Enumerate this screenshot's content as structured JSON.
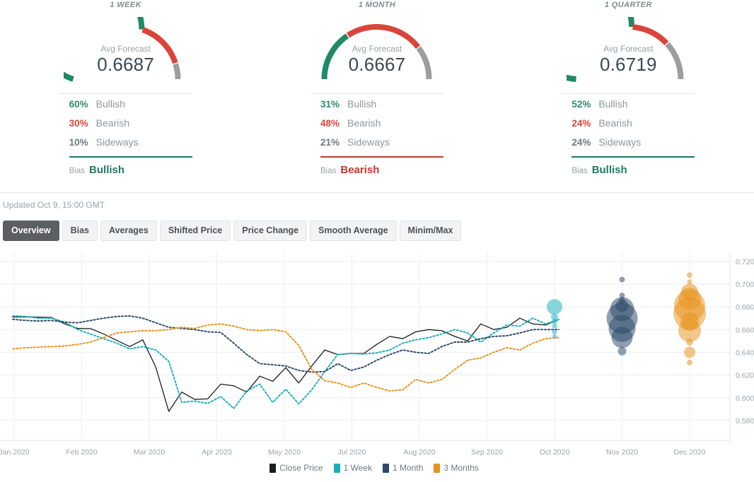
{
  "panels": [
    {
      "title": "1 WEEK",
      "gauge_caption": "Avg Forecast",
      "value": "0.6687",
      "bullish_pct": "60%",
      "bullish_label": "Bullish",
      "bearish_pct": "30%",
      "bearish_label": "Bearish",
      "sideways_pct": "10%",
      "sideways_label": "Sideways",
      "bias_label": "Bias",
      "bias_value": "Bullish",
      "bias_color": "#1f7a63",
      "arc": {
        "green": 60,
        "red": 30,
        "gray": 10
      }
    },
    {
      "title": "1 MONTH",
      "gauge_caption": "Avg Forecast",
      "value": "0.6667",
      "bullish_pct": "31%",
      "bullish_label": "Bullish",
      "bearish_pct": "48%",
      "bearish_label": "Bearish",
      "sideways_pct": "21%",
      "sideways_label": "Sideways",
      "bias_label": "Bias",
      "bias_value": "Bearish",
      "bias_color": "#c0392b",
      "arc": {
        "green": 31,
        "red": 48,
        "gray": 21
      }
    },
    {
      "title": "1 QUARTER",
      "gauge_caption": "Avg Forecast",
      "value": "0.6719",
      "bullish_pct": "52%",
      "bullish_label": "Bullish",
      "bearish_pct": "24%",
      "bearish_label": "Bearish",
      "sideways_pct": "24%",
      "sideways_label": "Sideways",
      "bias_label": "Bias",
      "bias_value": "Bullish",
      "bias_color": "#1f7a63",
      "arc": {
        "green": 52,
        "red": 24,
        "gray": 24
      }
    }
  ],
  "updated": "Updated Oct 9, 15:00 GMT",
  "tabs": [
    {
      "label": "Overview",
      "active": true
    },
    {
      "label": "Bias",
      "active": false
    },
    {
      "label": "Averages",
      "active": false
    },
    {
      "label": "Shifted Price",
      "active": false
    },
    {
      "label": "Price Change",
      "active": false
    },
    {
      "label": "Smooth Average",
      "active": false
    },
    {
      "label": "Minim/Max",
      "active": false
    }
  ],
  "colors": {
    "green": "#1f8a64",
    "red": "#d9453a",
    "gray": "#9e9e9e",
    "close_price": "#1c1c1c",
    "one_week": "#17b0bd",
    "one_month": "#2b4868",
    "three_months": "#e8931f"
  },
  "chart_data": {
    "type": "line",
    "title": "",
    "xlabel": "",
    "ylabel": "",
    "ylim": [
      0.57,
      0.7255
    ],
    "grid": true,
    "legend_position": "bottom",
    "yticks": [
      "0.7200",
      "0.7000",
      "0.6800",
      "0.6600",
      "0.6400",
      "0.6200",
      "0.6000",
      "0.5800"
    ],
    "ytick_values": [
      0.72,
      0.7,
      0.68,
      0.66,
      0.64,
      0.62,
      0.6,
      0.58
    ],
    "xticks": [
      "Jan 2020",
      "Feb 2020",
      "Mar 2020",
      "Apr 2020",
      "May 2020",
      "Jul 2020",
      "Aug 2020",
      "Sep 2020",
      "Oct 2020",
      "Nov 2020",
      "Dec 2020"
    ],
    "legend": [
      {
        "name": "Close Price",
        "color": "#1c1c1c"
      },
      {
        "name": "1 Week",
        "color": "#17b0bd"
      },
      {
        "name": "1 Month",
        "color": "#2b4868"
      },
      {
        "name": "3 Months",
        "color": "#e8931f"
      }
    ],
    "series": [
      {
        "name": "Close Price",
        "color": "#1c1c1c",
        "style": "solid",
        "values": [
          0.671,
          0.6712,
          0.6709,
          0.6706,
          0.665,
          0.661,
          0.6608,
          0.656,
          0.6505,
          0.645,
          0.651,
          0.627,
          0.588,
          0.605,
          0.5985,
          0.599,
          0.612,
          0.6105,
          0.605,
          0.619,
          0.6145,
          0.6265,
          0.613,
          0.628,
          0.642,
          0.638,
          0.639,
          0.639,
          0.647,
          0.654,
          0.652,
          0.658,
          0.66,
          0.659,
          0.654,
          0.65,
          0.665,
          0.66,
          0.662,
          0.67,
          0.665,
          0.664,
          0.669
        ]
      },
      {
        "name": "1 Week",
        "color": "#17b0bd",
        "style": "dotted",
        "values": [
          0.672,
          0.6715,
          0.67,
          0.67,
          0.6665,
          0.66,
          0.656,
          0.652,
          0.648,
          0.643,
          0.645,
          0.642,
          0.632,
          0.596,
          0.597,
          0.595,
          0.601,
          0.5905,
          0.606,
          0.612,
          0.596,
          0.6075,
          0.5945,
          0.607,
          0.623,
          0.638,
          0.639,
          0.6385,
          0.6395,
          0.642,
          0.648,
          0.651,
          0.653,
          0.656,
          0.66,
          0.657,
          0.649,
          0.657,
          0.664,
          0.663,
          0.67,
          0.665,
          0.6688
        ]
      },
      {
        "name": "1 Month",
        "color": "#2b4868",
        "style": "dotted",
        "values": [
          0.669,
          0.668,
          0.6675,
          0.668,
          0.6665,
          0.666,
          0.668,
          0.67,
          0.6715,
          0.672,
          0.67,
          0.666,
          0.662,
          0.661,
          0.66,
          0.658,
          0.6575,
          0.648,
          0.638,
          0.63,
          0.629,
          0.628,
          0.624,
          0.6225,
          0.623,
          0.63,
          0.624,
          0.627,
          0.633,
          0.638,
          0.642,
          0.64,
          0.639,
          0.645,
          0.649,
          0.649,
          0.652,
          0.654,
          0.6545,
          0.657,
          0.66,
          0.66,
          0.66
        ]
      },
      {
        "name": "3 Months",
        "color": "#e8931f",
        "style": "dotted",
        "values": [
          0.643,
          0.644,
          0.6445,
          0.645,
          0.6455,
          0.647,
          0.649,
          0.653,
          0.657,
          0.658,
          0.659,
          0.659,
          0.66,
          0.662,
          0.661,
          0.664,
          0.665,
          0.663,
          0.66,
          0.659,
          0.66,
          0.658,
          0.646,
          0.625,
          0.615,
          0.613,
          0.609,
          0.613,
          0.609,
          0.606,
          0.607,
          0.616,
          0.613,
          0.616,
          0.625,
          0.633,
          0.635,
          0.64,
          0.644,
          0.642,
          0.648,
          0.652,
          0.653
        ]
      }
    ],
    "bubble_clusters": [
      {
        "name": "1 Week",
        "color": "#17b0bd",
        "x_label": "Oct 2020",
        "points": [
          {
            "value": 0.68,
            "weight": 11
          },
          {
            "value": 0.671,
            "weight": 5
          },
          {
            "value": 0.667,
            "weight": 4
          },
          {
            "value": 0.663,
            "weight": 3.5
          },
          {
            "value": 0.658,
            "weight": 3.5
          },
          {
            "value": 0.654,
            "weight": 3
          }
        ]
      },
      {
        "name": "1 Month",
        "color": "#2b4868",
        "x_label": "Nov 2020",
        "points": [
          {
            "value": 0.704,
            "weight": 4
          },
          {
            "value": 0.69,
            "weight": 4
          },
          {
            "value": 0.6855,
            "weight": 4.5
          },
          {
            "value": 0.681,
            "weight": 9
          },
          {
            "value": 0.678,
            "weight": 17
          },
          {
            "value": 0.67,
            "weight": 22
          },
          {
            "value": 0.661,
            "weight": 19
          },
          {
            "value": 0.653,
            "weight": 15
          },
          {
            "value": 0.641,
            "weight": 6
          }
        ]
      },
      {
        "name": "3 Months",
        "color": "#e8931f",
        "x_label": "Dec 2020",
        "points": [
          {
            "value": 0.708,
            "weight": 4
          },
          {
            "value": 0.702,
            "weight": 3.5
          },
          {
            "value": 0.693,
            "weight": 12
          },
          {
            "value": 0.687,
            "weight": 16
          },
          {
            "value": 0.681,
            "weight": 22
          },
          {
            "value": 0.674,
            "weight": 23
          },
          {
            "value": 0.667,
            "weight": 13
          },
          {
            "value": 0.659,
            "weight": 16
          },
          {
            "value": 0.649,
            "weight": 5
          },
          {
            "value": 0.64,
            "weight": 8
          },
          {
            "value": 0.631,
            "weight": 4
          }
        ]
      }
    ]
  }
}
